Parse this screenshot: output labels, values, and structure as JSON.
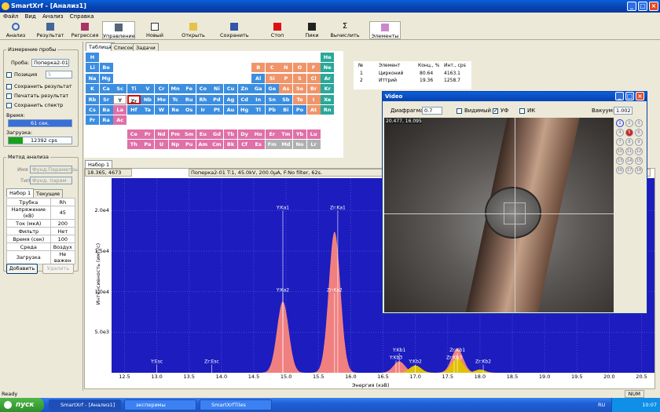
{
  "window": {
    "title": "SmartXrf - [Анализ1]"
  },
  "menu": [
    "Файл",
    "Вид",
    "Анализ",
    "Справка"
  ],
  "toolbar": [
    {
      "label": "Анализ",
      "icon": "magnifier-icon"
    },
    {
      "label": "Результат",
      "icon": "result-icon"
    },
    {
      "label": "Регрессия",
      "icon": "regression-icon"
    },
    {
      "label": "Управление",
      "icon": "control-icon"
    },
    {
      "label": "Новый",
      "icon": "new-doc-icon"
    },
    {
      "label": "Открыть",
      "icon": "open-icon"
    },
    {
      "label": "Сохранить",
      "icon": "save-icon"
    },
    {
      "label": "Стоп",
      "icon": "stop-icon"
    },
    {
      "label": "Пики",
      "icon": "peaks-icon"
    },
    {
      "label": "Вычислить",
      "icon": "sigma-icon"
    },
    {
      "label": "Элементы",
      "icon": "elements-icon"
    }
  ],
  "left": {
    "measure_legend": "Измерение пробы",
    "probe_label": "Проба:",
    "probe_value": "Поперка2-01",
    "position_label": "Позиция",
    "position_value": "5",
    "save_result": "Сохранить результат",
    "print_result": "Печатать результат",
    "save_spectrum": "Сохранить спектр",
    "time_label": "Время:",
    "time_value": "61 сек.",
    "time_fill": 1.0,
    "load_label": "Загрузка:",
    "load_value": "12392 cps",
    "load_fill": 0.22,
    "method_legend": "Метод анализа",
    "name_label": "Имя",
    "name_value": "Фунд.Параметры",
    "type_label": "Тип:",
    "type_value": "Фунд. парам",
    "tabs": [
      "Набор 1",
      "Текущие"
    ],
    "params": [
      [
        "Трубка",
        "Rh"
      ],
      [
        "Напряжение (кВ)",
        "45"
      ],
      [
        "Ток (мкА)",
        "200"
      ],
      [
        "Фильтр",
        "Нет"
      ],
      [
        "Время (сек)",
        "100"
      ],
      [
        "Среда",
        "Воздух"
      ],
      [
        "Загрузка",
        "Не важен"
      ]
    ],
    "add_btn": "Добавить",
    "delete_btn": "Удалить"
  },
  "tabs_top": [
    "Таблица",
    "Список",
    "Задачи"
  ],
  "elements_table": {
    "headers": [
      "№",
      "Элемент",
      "Конц., %",
      "Инт., cps"
    ],
    "rows": [
      [
        "1",
        "Цирконий",
        "80.64",
        "4163.1"
      ],
      [
        "2",
        "Иттрий",
        "19.36",
        "1258.7"
      ]
    ]
  },
  "graph": {
    "tab": "Набор 1",
    "coords": "18.365, 4673",
    "info": "Поперка2-01   T:1, 45.0kV, 200.0µA, F:No filter, 62s.",
    "ylabel": "Интенсивность (имп/с)",
    "xlabel": "Энергия (кэВ)"
  },
  "chart_data": {
    "type": "area",
    "xlabel": "Энергия (кэВ)",
    "ylabel": "Интенсивность (имп/с)",
    "xlim": [
      12.3,
      20.7
    ],
    "ylim": [
      0,
      2400
    ],
    "x_ticks": [
      12.5,
      13.0,
      13.5,
      14.0,
      14.5,
      15.0,
      15.5,
      16.0,
      16.5,
      17.0,
      17.5,
      18.0,
      18.5,
      19.0,
      19.5,
      20.0,
      20.5
    ],
    "y_ticks": [
      "5.0e3",
      "1.0e4",
      "1.5e4",
      "2.0e4"
    ],
    "y_tick_values": [
      500,
      1000,
      1500,
      2000
    ],
    "series": [
      {
        "name": "Y",
        "color": "#f08080",
        "peaks": [
          {
            "x": 14.95,
            "h": 880,
            "w": 0.09
          },
          {
            "x": 16.75,
            "h": 140,
            "w": 0.09
          }
        ]
      },
      {
        "name": "Zr",
        "color": "#f08080",
        "peaks": [
          {
            "x": 15.75,
            "h": 1740,
            "w": 0.09
          },
          {
            "x": 17.65,
            "h": 300,
            "w": 0.09
          }
        ]
      },
      {
        "name": "Rh",
        "color": "#e0c000",
        "peaks": [
          {
            "x": 17.0,
            "h": 90,
            "w": 0.09
          },
          {
            "x": 17.65,
            "h": 180,
            "w": 0.09
          },
          {
            "x": 18.0,
            "h": 40,
            "w": 0.08
          }
        ]
      }
    ],
    "annotations": [
      {
        "text": "Y:Esc",
        "x": 13.0,
        "y": 120
      },
      {
        "text": "Zr:Esc",
        "x": 13.85,
        "y": 120
      },
      {
        "text": "Y:Ka1",
        "x": 14.95,
        "y": 2020
      },
      {
        "text": "Zr:Ka1",
        "x": 15.8,
        "y": 2020
      },
      {
        "text": "Y:Ka2",
        "x": 14.95,
        "y": 1000
      },
      {
        "text": "Zr:Ka2",
        "x": 15.75,
        "y": 1000
      },
      {
        "text": "Y:Kb1",
        "x": 16.75,
        "y": 260
      },
      {
        "text": "Y:Kb3",
        "x": 16.7,
        "y": 170
      },
      {
        "text": "Zr:Kb1",
        "x": 17.65,
        "y": 260
      },
      {
        "text": "Zr:Kb3",
        "x": 17.6,
        "y": 170
      },
      {
        "text": "Y:Kb2",
        "x": 17.0,
        "y": 120
      },
      {
        "text": "Zr:Kb2",
        "x": 18.05,
        "y": 120
      }
    ]
  },
  "video": {
    "title": "Video",
    "aperture_label": "Диафрагма:",
    "aperture_value": "0.7",
    "visible": "Видимый",
    "uv": "УФ",
    "ir": "ИК",
    "zoom_label": "Вакуум:",
    "zoom_value": "1.002",
    "coords": "20.477, 16.095",
    "grid": [
      [
        "1",
        "2",
        "3"
      ],
      [
        "4",
        "5",
        "6"
      ],
      [
        "7",
        "8",
        "9"
      ],
      [
        "10",
        "11",
        "12"
      ],
      [
        "13",
        "14",
        "15"
      ],
      [
        "16",
        "17",
        "18"
      ]
    ]
  },
  "status": {
    "text": "Ready",
    "num": "NUM"
  },
  "taskbar": {
    "start": "пуск",
    "tasks": [
      "SmartXrf - [Анализ1]",
      "эксперимы",
      "SmartXrfTiles"
    ],
    "lang": "RU",
    "time": "10:07"
  },
  "periodic": {
    "cells": [
      {
        "s": "H",
        "r": 0,
        "c": 0,
        "t": "b"
      },
      {
        "s": "He",
        "r": 0,
        "c": 17,
        "t": "t"
      },
      {
        "s": "Li",
        "r": 1,
        "c": 0,
        "t": "b"
      },
      {
        "s": "Be",
        "r": 1,
        "c": 1,
        "t": "b"
      },
      {
        "s": "B",
        "r": 1,
        "c": 12,
        "t": "o"
      },
      {
        "s": "C",
        "r": 1,
        "c": 13,
        "t": "o"
      },
      {
        "s": "N",
        "r": 1,
        "c": 14,
        "t": "o"
      },
      {
        "s": "O",
        "r": 1,
        "c": 15,
        "t": "o"
      },
      {
        "s": "F",
        "r": 1,
        "c": 16,
        "t": "o"
      },
      {
        "s": "Ne",
        "r": 1,
        "c": 17,
        "t": "t"
      },
      {
        "s": "Na",
        "r": 2,
        "c": 0,
        "t": "b"
      },
      {
        "s": "Mg",
        "r": 2,
        "c": 1,
        "t": "b"
      },
      {
        "s": "Al",
        "r": 2,
        "c": 12,
        "t": "b"
      },
      {
        "s": "Si",
        "r": 2,
        "c": 13,
        "t": "o"
      },
      {
        "s": "P",
        "r": 2,
        "c": 14,
        "t": "o"
      },
      {
        "s": "S",
        "r": 2,
        "c": 15,
        "t": "o"
      },
      {
        "s": "Cl",
        "r": 2,
        "c": 16,
        "t": "o"
      },
      {
        "s": "Ar",
        "r": 2,
        "c": 17,
        "t": "t"
      },
      {
        "s": "K",
        "r": 3,
        "c": 0,
        "t": "b"
      },
      {
        "s": "Ca",
        "r": 3,
        "c": 1,
        "t": "b"
      },
      {
        "s": "Sc",
        "r": 3,
        "c": 2,
        "t": "b"
      },
      {
        "s": "Ti",
        "r": 3,
        "c": 3,
        "t": "b"
      },
      {
        "s": "V",
        "r": 3,
        "c": 4,
        "t": "b"
      },
      {
        "s": "Cr",
        "r": 3,
        "c": 5,
        "t": "b"
      },
      {
        "s": "Mn",
        "r": 3,
        "c": 6,
        "t": "b"
      },
      {
        "s": "Fe",
        "r": 3,
        "c": 7,
        "t": "b"
      },
      {
        "s": "Co",
        "r": 3,
        "c": 8,
        "t": "b"
      },
      {
        "s": "Ni",
        "r": 3,
        "c": 9,
        "t": "b"
      },
      {
        "s": "Cu",
        "r": 3,
        "c": 10,
        "t": "b"
      },
      {
        "s": "Zn",
        "r": 3,
        "c": 11,
        "t": "b"
      },
      {
        "s": "Ga",
        "r": 3,
        "c": 12,
        "t": "b"
      },
      {
        "s": "Ge",
        "r": 3,
        "c": 13,
        "t": "b"
      },
      {
        "s": "As",
        "r": 3,
        "c": 14,
        "t": "o"
      },
      {
        "s": "Se",
        "r": 3,
        "c": 15,
        "t": "o"
      },
      {
        "s": "Br",
        "r": 3,
        "c": 16,
        "t": "o"
      },
      {
        "s": "Kr",
        "r": 3,
        "c": 17,
        "t": "t"
      },
      {
        "s": "Rb",
        "r": 4,
        "c": 0,
        "t": "b"
      },
      {
        "s": "Sr",
        "r": 4,
        "c": 1,
        "t": "b"
      },
      {
        "s": "Y",
        "r": 4,
        "c": 2,
        "t": "w"
      },
      {
        "s": "Zr",
        "r": 4,
        "c": 3,
        "t": "w"
      },
      {
        "s": "Nb",
        "r": 4,
        "c": 4,
        "t": "b"
      },
      {
        "s": "Mo",
        "r": 4,
        "c": 5,
        "t": "b"
      },
      {
        "s": "Tc",
        "r": 4,
        "c": 6,
        "t": "b"
      },
      {
        "s": "Ru",
        "r": 4,
        "c": 7,
        "t": "b"
      },
      {
        "s": "Rh",
        "r": 4,
        "c": 8,
        "t": "b"
      },
      {
        "s": "Pd",
        "r": 4,
        "c": 9,
        "t": "b"
      },
      {
        "s": "Ag",
        "r": 4,
        "c": 10,
        "t": "b"
      },
      {
        "s": "Cd",
        "r": 4,
        "c": 11,
        "t": "b"
      },
      {
        "s": "In",
        "r": 4,
        "c": 12,
        "t": "b"
      },
      {
        "s": "Sn",
        "r": 4,
        "c": 13,
        "t": "b"
      },
      {
        "s": "Sb",
        "r": 4,
        "c": 14,
        "t": "b"
      },
      {
        "s": "Te",
        "r": 4,
        "c": 15,
        "t": "o"
      },
      {
        "s": "I",
        "r": 4,
        "c": 16,
        "t": "o"
      },
      {
        "s": "Xe",
        "r": 4,
        "c": 17,
        "t": "t"
      },
      {
        "s": "Cs",
        "r": 5,
        "c": 0,
        "t": "b"
      },
      {
        "s": "Ba",
        "r": 5,
        "c": 1,
        "t": "b"
      },
      {
        "s": "La",
        "r": 5,
        "c": 2,
        "t": "p"
      },
      {
        "s": "Hf",
        "r": 5,
        "c": 3,
        "t": "b"
      },
      {
        "s": "Ta",
        "r": 5,
        "c": 4,
        "t": "b"
      },
      {
        "s": "W",
        "r": 5,
        "c": 5,
        "t": "b"
      },
      {
        "s": "Re",
        "r": 5,
        "c": 6,
        "t": "b"
      },
      {
        "s": "Os",
        "r": 5,
        "c": 7,
        "t": "b"
      },
      {
        "s": "Ir",
        "r": 5,
        "c": 8,
        "t": "b"
      },
      {
        "s": "Pt",
        "r": 5,
        "c": 9,
        "t": "b"
      },
      {
        "s": "Au",
        "r": 5,
        "c": 10,
        "t": "b"
      },
      {
        "s": "Hg",
        "r": 5,
        "c": 11,
        "t": "b"
      },
      {
        "s": "Tl",
        "r": 5,
        "c": 12,
        "t": "b"
      },
      {
        "s": "Pb",
        "r": 5,
        "c": 13,
        "t": "b"
      },
      {
        "s": "Bi",
        "r": 5,
        "c": 14,
        "t": "b"
      },
      {
        "s": "Po",
        "r": 5,
        "c": 15,
        "t": "b"
      },
      {
        "s": "At",
        "r": 5,
        "c": 16,
        "t": "o"
      },
      {
        "s": "Rn",
        "r": 5,
        "c": 17,
        "t": "t"
      },
      {
        "s": "Fr",
        "r": 6,
        "c": 0,
        "t": "b"
      },
      {
        "s": "Ra",
        "r": 6,
        "c": 1,
        "t": "b"
      },
      {
        "s": "Ac",
        "r": 6,
        "c": 2,
        "t": "p"
      },
      {
        "s": "Ce",
        "r": 7,
        "c": 3,
        "t": "p"
      },
      {
        "s": "Pr",
        "r": 7,
        "c": 4,
        "t": "p"
      },
      {
        "s": "Nd",
        "r": 7,
        "c": 5,
        "t": "p"
      },
      {
        "s": "Pm",
        "r": 7,
        "c": 6,
        "t": "p"
      },
      {
        "s": "Sm",
        "r": 7,
        "c": 7,
        "t": "p"
      },
      {
        "s": "Eu",
        "r": 7,
        "c": 8,
        "t": "p"
      },
      {
        "s": "Gd",
        "r": 7,
        "c": 9,
        "t": "p"
      },
      {
        "s": "Tb",
        "r": 7,
        "c": 10,
        "t": "p"
      },
      {
        "s": "Dy",
        "r": 7,
        "c": 11,
        "t": "p"
      },
      {
        "s": "Ho",
        "r": 7,
        "c": 12,
        "t": "p"
      },
      {
        "s": "Er",
        "r": 7,
        "c": 13,
        "t": "p"
      },
      {
        "s": "Tm",
        "r": 7,
        "c": 14,
        "t": "p"
      },
      {
        "s": "Yb",
        "r": 7,
        "c": 15,
        "t": "p"
      },
      {
        "s": "Lu",
        "r": 7,
        "c": 16,
        "t": "p"
      },
      {
        "s": "Th",
        "r": 8,
        "c": 3,
        "t": "p"
      },
      {
        "s": "Pa",
        "r": 8,
        "c": 4,
        "t": "p"
      },
      {
        "s": "U",
        "r": 8,
        "c": 5,
        "t": "p"
      },
      {
        "s": "Np",
        "r": 8,
        "c": 6,
        "t": "p"
      },
      {
        "s": "Pu",
        "r": 8,
        "c": 7,
        "t": "p"
      },
      {
        "s": "Am",
        "r": 8,
        "c": 8,
        "t": "p"
      },
      {
        "s": "Cm",
        "r": 8,
        "c": 9,
        "t": "p"
      },
      {
        "s": "Bk",
        "r": 8,
        "c": 10,
        "t": "p"
      },
      {
        "s": "Cf",
        "r": 8,
        "c": 11,
        "t": "p"
      },
      {
        "s": "Es",
        "r": 8,
        "c": 12,
        "t": "p"
      },
      {
        "s": "Fm",
        "r": 8,
        "c": 13,
        "t": "g"
      },
      {
        "s": "Md",
        "r": 8,
        "c": 14,
        "t": "g"
      },
      {
        "s": "No",
        "r": 8,
        "c": 15,
        "t": "g"
      },
      {
        "s": "Lr",
        "r": 8,
        "c": 16,
        "t": "g"
      }
    ],
    "colors": {
      "b": "#3c8ee0",
      "o": "#f0956a",
      "t": "#2aa89a",
      "p": "#e070a8",
      "g": "#b0b0b0",
      "w": "#ffffff"
    }
  }
}
